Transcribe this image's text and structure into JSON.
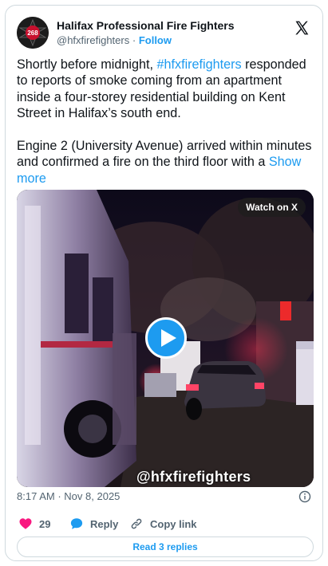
{
  "author": {
    "name": "Halifax Professional Fire Fighters",
    "handle": "@hfxfirefighters",
    "separator": "·",
    "follow_label": "Follow",
    "avatar_text": "268"
  },
  "tweet": {
    "p1_before": "Shortly before midnight, ",
    "hashtag": "#hfxfirefighters",
    "p1_after": " responded to reports of smoke coming from an apartment inside a four-storey residential building on Kent Street in Halifax’s south end.",
    "p2": "Engine 2 (University Avenue) arrived within minutes and confirmed a fire on the third floor with a ",
    "show_more": "Show more"
  },
  "video": {
    "watch_label": "Watch on X",
    "watermark": "@hfxfirefighters"
  },
  "meta": {
    "time": "8:17 AM",
    "separator": "·",
    "date": "Nov 8, 2025"
  },
  "actions": {
    "likes": "29",
    "reply_label": "Reply",
    "copy_label": "Copy link"
  },
  "read_replies_label": "Read 3 replies",
  "colors": {
    "accent": "#1d9bf0",
    "like": "#f91880",
    "muted": "#536471",
    "border": "#cfd9de"
  },
  "icons": [
    "x-logo-icon",
    "play-icon",
    "info-icon",
    "heart-icon",
    "reply-bubble-icon",
    "link-icon"
  ]
}
